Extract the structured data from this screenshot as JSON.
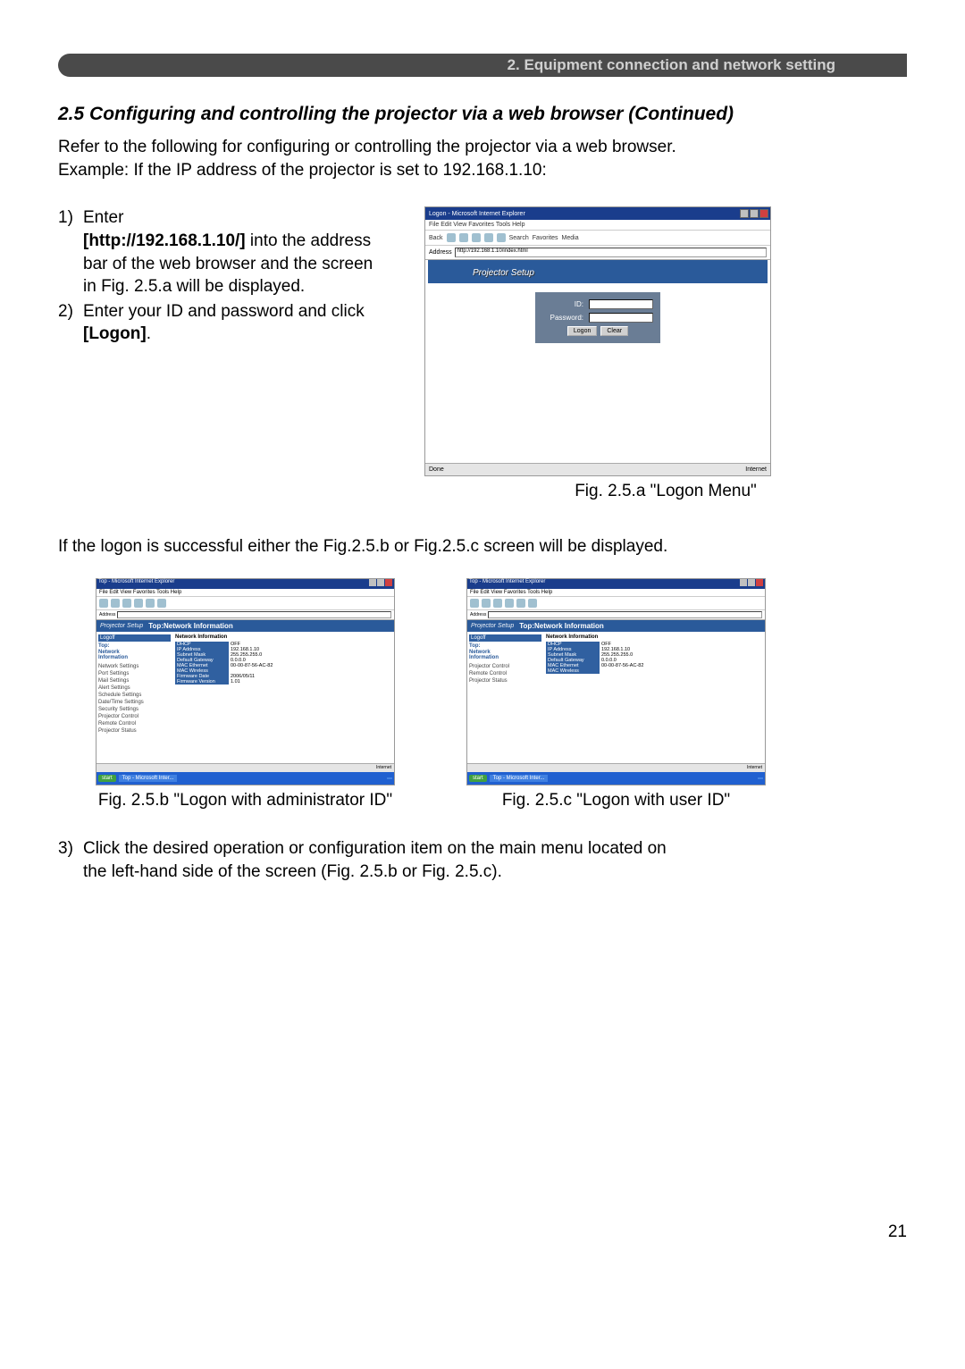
{
  "chapter": "2. Equipment connection and network setting",
  "section_title": "2.5 Configuring and controlling the projector via a web browser (Continued)",
  "intro_lines": [
    "Refer to the following for configuring or controlling the projector via a web browser.",
    "Example: If the IP address of the projector is set to 192.168.1.10:"
  ],
  "step1": {
    "num": "1)",
    "lead": " Enter",
    "bold_url": "[http://192.168.1.10/]",
    "rest1": " into the address",
    "line2": "bar of the web browser and the screen",
    "line3": "in Fig. 2.5.a will be displayed."
  },
  "step2": {
    "num": "2)",
    "line1a": " Enter your ID and password and click",
    "bold": "[Logon]",
    "dot": "."
  },
  "fig_a_caption": "Fig. 2.5.a \"Logon Menu\"",
  "mid_text": "If the logon is successful either the Fig.2.5.b or Fig.2.5.c screen will be displayed.",
  "fig_b_caption": "Fig. 2.5.b \"Logon with administrator ID\"",
  "fig_c_caption": "Fig. 2.5.c \"Logon with user ID\"",
  "step3": {
    "num": "3)",
    "line1": " Click the desired operation or configuration item on the main menu located on",
    "line2": "the left-hand side of the screen (Fig. 2.5.b or Fig. 2.5.c)."
  },
  "page_number": "21",
  "browser_a": {
    "title": "Logon - Microsoft Internet Explorer",
    "menubar": "File  Edit  View  Favorites  Tools  Help",
    "toolbar": {
      "back": "Back",
      "search": "Search",
      "favorites": "Favorites",
      "media": "Media"
    },
    "addr_label": "Address",
    "addr_value": "http://192.168.1.10/index.html",
    "banner": "Projector Setup",
    "logon": {
      "id_label": "ID:",
      "pw_label": "Password:",
      "logon_btn": "Logon",
      "clear_btn": "Clear"
    },
    "status_left": "Done",
    "status_right": "Internet"
  },
  "browser_b": {
    "title": "Top - Microsoft Internet Explorer",
    "menubar": "File  Edit  View  Favorites  Tools  Help",
    "addr_label": "Address",
    "banner_left": "Projector Setup",
    "banner_right": "Top:Network Information",
    "sidebar": {
      "logoff": "Logoff",
      "top_block": "Top:\nNetwork\nInformation",
      "items": [
        "Network Settings",
        "Port Settings",
        "Mail Settings",
        "Alert Settings",
        "Schedule Settings",
        "Date/Time Settings",
        "Security Settings",
        "Projector Control",
        "Remote Control",
        "Projector Status"
      ]
    },
    "ni_title": "Network Information",
    "ni_rows": [
      [
        "DHCP",
        "OFF"
      ],
      [
        "IP Address",
        "192.168.1.10"
      ],
      [
        "Subnet Mask",
        "255.255.255.0"
      ],
      [
        "Default Gateway",
        "0.0.0.0"
      ],
      [
        "MAC Ethernet",
        "00-00-87-56-AC-82"
      ],
      [
        "MAC Wireless",
        ""
      ],
      [
        "Firmware Date",
        "2006/05/11"
      ],
      [
        "Firmware Version",
        "1.01"
      ]
    ],
    "status_right": "Internet"
  },
  "browser_c": {
    "title": "Top - Microsoft Internet Explorer",
    "menubar": "File  Edit  View  Favorites  Tools  Help",
    "addr_label": "Address",
    "banner_left": "Projector Setup",
    "banner_right": "Top:Network Information",
    "sidebar": {
      "logoff": "Logoff",
      "top_block": "Top:\nNetwork\nInformation",
      "items": [
        "Projector Control",
        "Remote Control",
        "Projector Status"
      ]
    },
    "ni_title": "Network Information",
    "ni_rows": [
      [
        "DHCP",
        "OFF"
      ],
      [
        "IP Address",
        "192.168.1.10"
      ],
      [
        "Subnet Mask",
        "255.255.255.0"
      ],
      [
        "Default Gateway",
        "0.0.0.0"
      ],
      [
        "MAC Ethernet",
        "00-00-87-56-AC-82"
      ],
      [
        "MAC Wireless",
        ""
      ]
    ],
    "status_right": "Internet"
  }
}
